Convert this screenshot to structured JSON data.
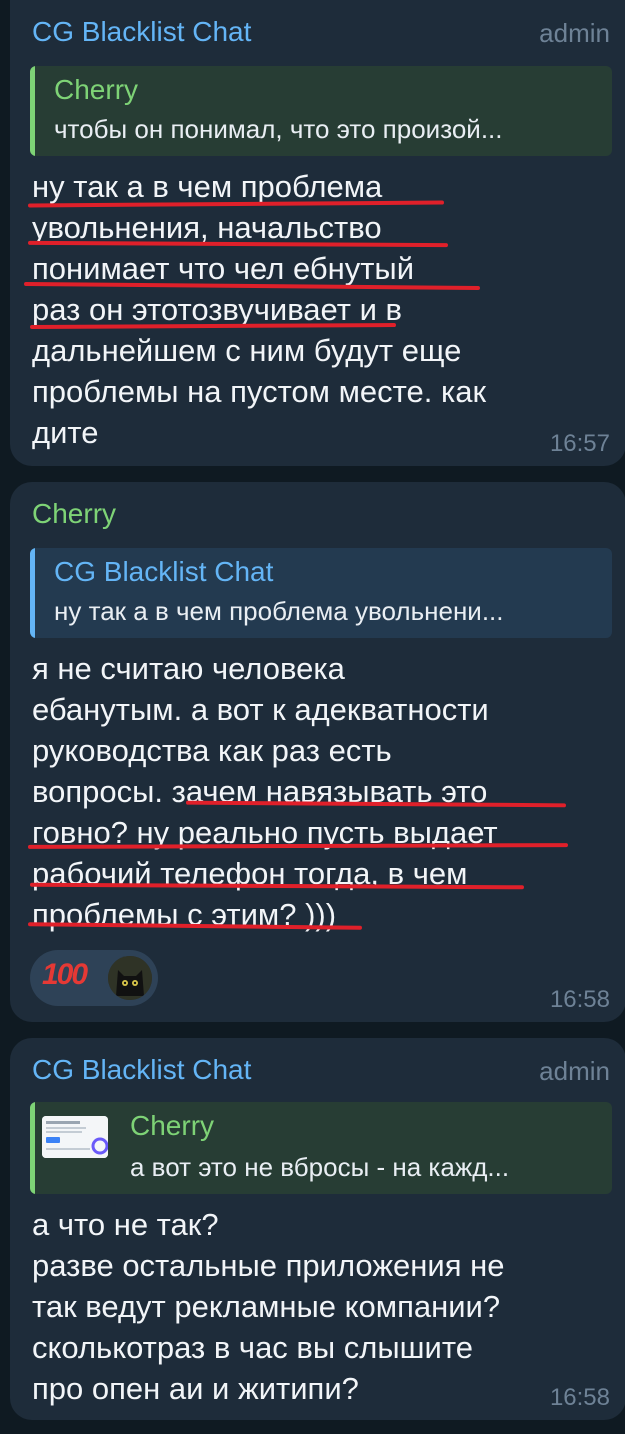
{
  "messages": [
    {
      "sender": "CG Blacklist Chat",
      "role": "admin",
      "reply": {
        "name": "Cherry",
        "text": "чтобы он понимал, что это произой..."
      },
      "lines": [
        "ну так а в чем проблема",
        "увольнения, начальство",
        "понимает что чел ебнутый",
        "раз он этотозвучивает и в",
        "дальнейшем с ним будут еще",
        "проблемы на пустом месте. как",
        "дите"
      ],
      "time": "16:57"
    },
    {
      "sender": "Cherry",
      "reply": {
        "name": "CG Blacklist Chat",
        "text": "ну так а в чем проблема увольнени..."
      },
      "lines": [
        "я не считаю человека",
        "ебанутым. а вот к адекватности",
        "руководства как раз есть",
        "вопросы. зачем навязывать это",
        "говно? ну реально пусть выдает",
        "рабочий телефон тогда, в чем",
        "проблемы с этим? )))"
      ],
      "reactions": {
        "emoji": "100"
      },
      "time": "16:58"
    },
    {
      "sender": "CG Blacklist Chat",
      "role": "admin",
      "reply": {
        "name": "Cherry",
        "text": "а вот это не вбросы - на кажд..."
      },
      "lines": [
        "а что не так?",
        "разве остальные приложения не",
        "так ведут рекламные компании?",
        "сколькотраз в час вы слышите",
        "про опен аи и житипи?"
      ],
      "time": "16:58"
    }
  ],
  "colors": {
    "background": "#0f1a22",
    "bubble": "#1e2c3a",
    "admin_name": "#64b5f6",
    "cherry_name": "#7ed376",
    "underline_markup": "#e0202a"
  }
}
